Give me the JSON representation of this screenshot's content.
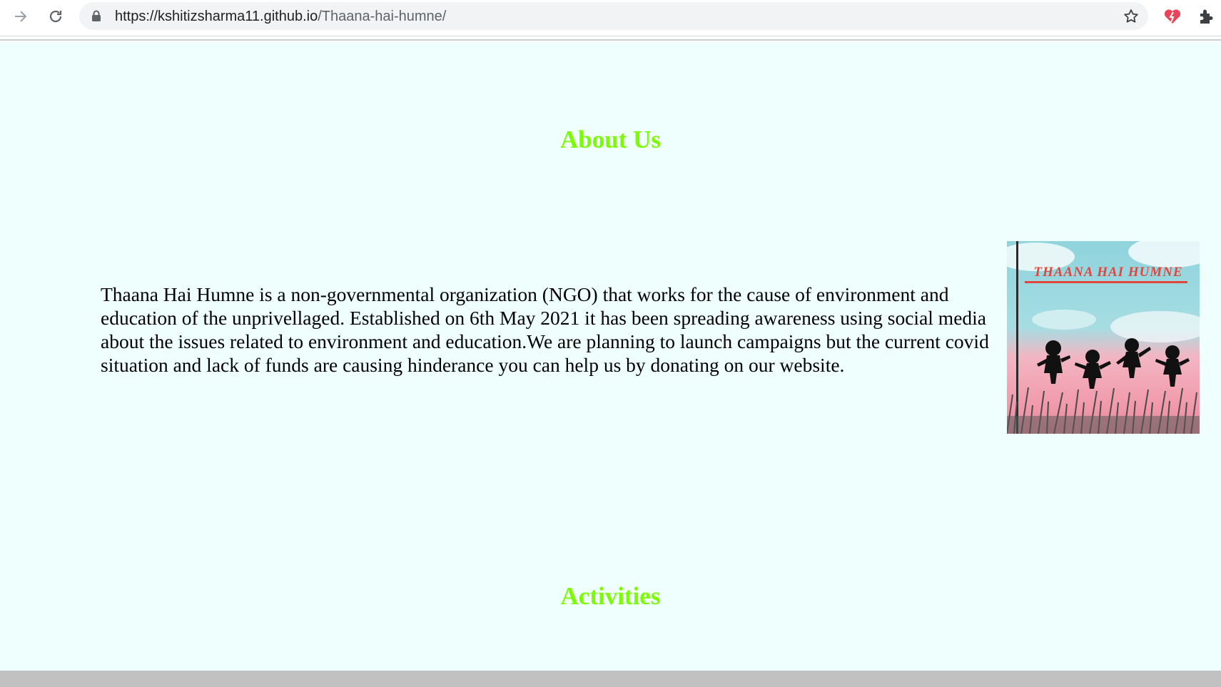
{
  "browser": {
    "url_host": "https://kshitizsharma11.github.io",
    "url_path": "/Thaana-hai-humne/",
    "icons": [
      "forward-arrow-icon",
      "reload-icon",
      "lock-icon",
      "star-icon",
      "heart-extension-icon",
      "puzzle-extension-icon"
    ]
  },
  "about": {
    "heading": "About Us",
    "text": "Thaana Hai Humne is a non-governmental organization (NGO) that works for the cause of environment and education of the unprivellaged. Established on 6th May 2021 it has been spreading awareness using social media about the issues related to environment and education.We are planning to launch campaigns but the current covid situation and lack of funds are causing hinderance you can help us by donating on our website.",
    "logo_text": "THAANA HAI HUMNE"
  },
  "activities": {
    "heading": "Activities"
  },
  "colors": {
    "page_background": "#eefffe",
    "heading_green": "#7cfc00",
    "logo_text_red": "#e0463c"
  }
}
